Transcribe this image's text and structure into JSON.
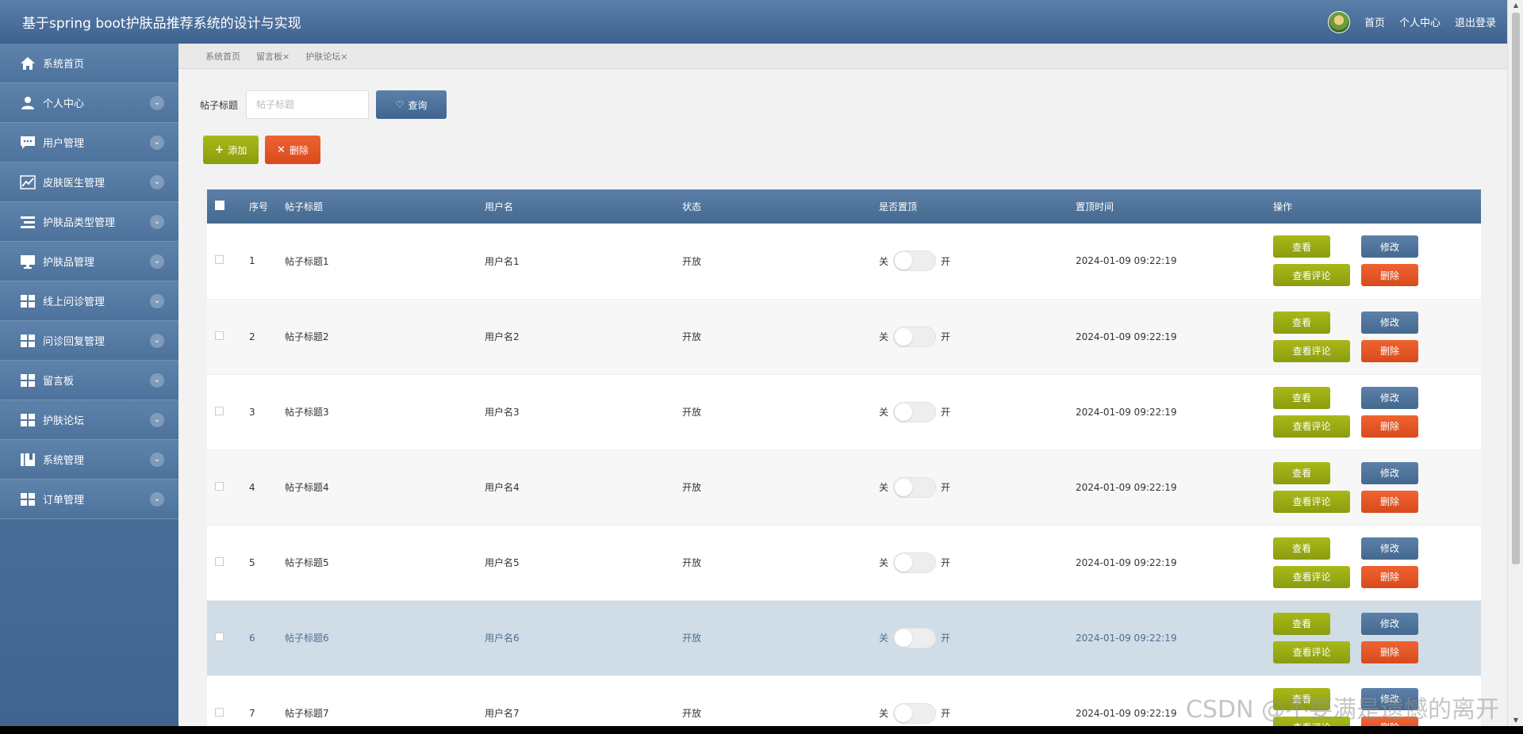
{
  "header": {
    "title": "基于spring boot护肤品推荐系统的设计与实现",
    "links": [
      "首页",
      "个人中心",
      "退出登录"
    ]
  },
  "sidebar": {
    "items": [
      {
        "label": "系统首页",
        "icon": "home-icon",
        "chevron": false
      },
      {
        "label": "个人中心",
        "icon": "user-icon",
        "chevron": true
      },
      {
        "label": "用户管理",
        "icon": "chat-icon",
        "chevron": true
      },
      {
        "label": "皮肤医生管理",
        "icon": "chart-icon",
        "chevron": true
      },
      {
        "label": "护肤品类型管理",
        "icon": "list-icon",
        "chevron": true
      },
      {
        "label": "护肤品管理",
        "icon": "monitor-icon",
        "chevron": true
      },
      {
        "label": "线上问诊管理",
        "icon": "grid-icon",
        "chevron": true
      },
      {
        "label": "问诊回复管理",
        "icon": "grid-icon",
        "chevron": true
      },
      {
        "label": "留言板",
        "icon": "grid-icon",
        "chevron": true
      },
      {
        "label": "护肤论坛",
        "icon": "grid-icon",
        "chevron": true
      },
      {
        "label": "系统管理",
        "icon": "book-icon",
        "chevron": true
      },
      {
        "label": "订单管理",
        "icon": "grid-icon",
        "chevron": true
      }
    ]
  },
  "tabs": [
    {
      "label": "系统首页"
    },
    {
      "label": "留言板×"
    },
    {
      "label": "护肤论坛×"
    }
  ],
  "search": {
    "label": "帖子标题",
    "placeholder": "帖子标题",
    "button": "查询"
  },
  "actions": {
    "add": "添加",
    "delete": "删除"
  },
  "table": {
    "columns": [
      "序号",
      "帖子标题",
      "用户名",
      "状态",
      "是否置顶",
      "置顶时间",
      "操作"
    ],
    "switch_off": "关",
    "switch_on": "开",
    "ops": {
      "view": "查看",
      "edit": "修改",
      "comments": "查看评论",
      "delete": "删除"
    },
    "rows": [
      {
        "index": "1",
        "title": "帖子标题1",
        "user": "用户名1",
        "status": "开放",
        "pin_time": "2024-01-09 09:22:19"
      },
      {
        "index": "2",
        "title": "帖子标题2",
        "user": "用户名2",
        "status": "开放",
        "pin_time": "2024-01-09 09:22:19"
      },
      {
        "index": "3",
        "title": "帖子标题3",
        "user": "用户名3",
        "status": "开放",
        "pin_time": "2024-01-09 09:22:19"
      },
      {
        "index": "4",
        "title": "帖子标题4",
        "user": "用户名4",
        "status": "开放",
        "pin_time": "2024-01-09 09:22:19"
      },
      {
        "index": "5",
        "title": "帖子标题5",
        "user": "用户名5",
        "status": "开放",
        "pin_time": "2024-01-09 09:22:19"
      },
      {
        "index": "6",
        "title": "帖子标题6",
        "user": "用户名6",
        "status": "开放",
        "pin_time": "2024-01-09 09:22:19"
      },
      {
        "index": "7",
        "title": "帖子标题7",
        "user": "用户名7",
        "status": "开放",
        "pin_time": "2024-01-09 09:22:19"
      }
    ]
  },
  "watermark": "CSDN @不要满是遗憾的离开"
}
